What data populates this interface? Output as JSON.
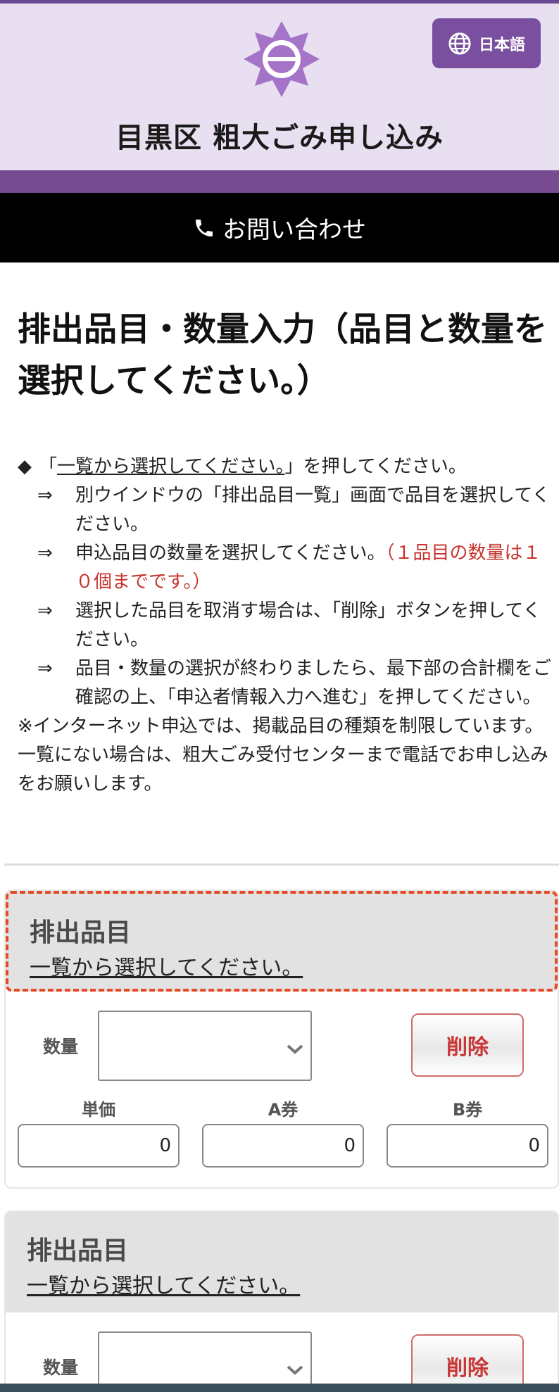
{
  "header": {
    "language_button": "日本語",
    "site_title": "目黒区 粗大ごみ申し込み",
    "contact_label": "お問い合わせ"
  },
  "main": {
    "heading": "排出品目・数量入力（品目と数量を選択してください。）",
    "instructions": {
      "lead_prefix": "「",
      "lead_link": "一覧から選択してください。",
      "lead_suffix": "」を押してください。",
      "items": [
        "別ウインドウの「排出品目一覧」画面で品目を選択してください。",
        "申込品目の数量を選択してください。",
        "選択した品目を取消す場合は、「削除」ボタンを押してください。",
        "品目・数量の選択が終わりましたら、最下部の合計欄をご確認の上、「申込者情報入力へ進む」を押してください。"
      ],
      "limit_note": "（１品目の数量は１０個までです。）",
      "footnote": "※インターネット申込では、掲載品目の種類を制限しています。一覧にない場合は、粗大ごみ受付センターまで電話でお申し込みをお願いします。"
    }
  },
  "cards": [
    {
      "item_label": "排出品目",
      "pick_link": "一覧から選択してください。",
      "quantity_label": "数量",
      "quantity_value": "",
      "delete_label": "削除",
      "unit_price_label": "単価",
      "a_ticket_label": "A券",
      "b_ticket_label": "B券",
      "unit_price": "0",
      "a_ticket": "0",
      "b_ticket": "0"
    },
    {
      "item_label": "排出品目",
      "pick_link": "一覧から選択してください。",
      "quantity_label": "数量",
      "quantity_value": "",
      "delete_label": "削除"
    }
  ],
  "colors": {
    "header_bg": "#e8e0f1",
    "brand_purple": "#774b92",
    "language_button_bg": "#7a4f9f",
    "contact_bar_bg": "#000000",
    "focus_outline": "#e64a24",
    "delete_text": "#c83636",
    "limit_note": "#c8322c"
  },
  "icons": {
    "emblem": "meguro-emblem-icon",
    "language": "globe-icon",
    "contact": "phone-icon",
    "select": "chevron-down-icon"
  }
}
